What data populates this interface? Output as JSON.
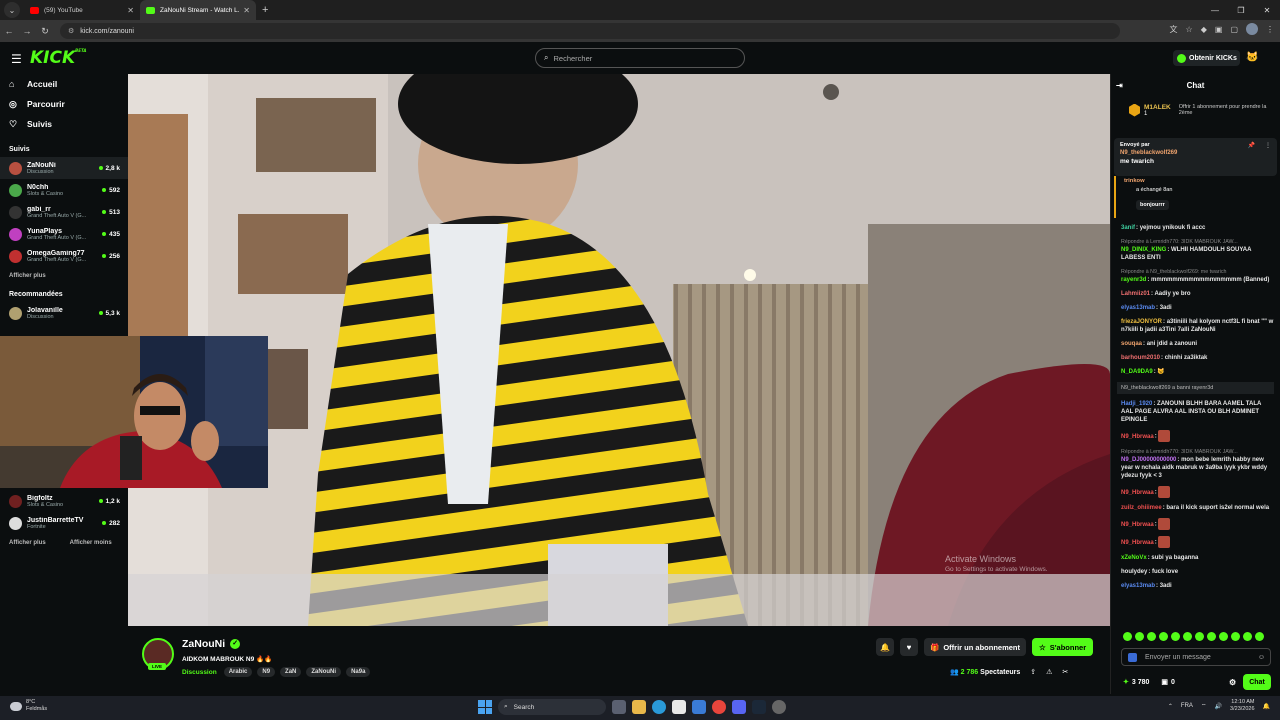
{
  "browser": {
    "tabs": [
      {
        "title": "(59) YouTube",
        "favicon_color": "#ff0000"
      },
      {
        "title": "ZaNouNi Stream - Watch L...",
        "favicon_color": "#53fc18"
      }
    ],
    "address": "kick.com/zanouni"
  },
  "header": {
    "logo": "KICK",
    "logo_sup": "BETA",
    "search_placeholder": "Rechercher",
    "get_kicks": "Obtenir KICKs"
  },
  "sidebar": {
    "nav": [
      {
        "label": "Accueil",
        "icon": "home-icon"
      },
      {
        "label": "Parcourir",
        "icon": "compass-icon"
      },
      {
        "label": "Suivis",
        "icon": "heart-icon"
      }
    ],
    "followed_title": "Suivis",
    "followed": [
      {
        "name": "ZaNouNi",
        "category": "Discussion",
        "viewers": "2,8 k",
        "color": "#b85040"
      },
      {
        "name": "N0chh",
        "category": "Slots & Casino",
        "viewers": "592",
        "color": "#4aa84a"
      },
      {
        "name": "gabi_rr",
        "category": "Grand Theft Auto V (G...",
        "viewers": "513",
        "color": "#333333"
      },
      {
        "name": "YunaPlays",
        "category": "Grand Theft Auto V (G...",
        "viewers": "435",
        "color": "#c040c0"
      },
      {
        "name": "OmegaGaming77",
        "category": "Grand Theft Auto V (G...",
        "viewers": "256",
        "color": "#c03030"
      }
    ],
    "show_more_1": "Afficher plus",
    "recommended_title": "Recommandées",
    "recommended": [
      {
        "name": "Jolavanille",
        "category": "Discussion",
        "viewers": "5,3 k",
        "color": "#b0a070"
      }
    ],
    "recommended_bottom": [
      {
        "name": "Bigfoltz",
        "category": "Slots & Casino",
        "viewers": "1,2 k",
        "color": "#702020"
      },
      {
        "name": "JustinBarretteTV",
        "category": "Fortnite",
        "viewers": "282",
        "color": "#dddddd"
      }
    ],
    "show_more_2": "Afficher plus",
    "show_less": "Afficher moins"
  },
  "video": {
    "watermark_title": "Activate Windows",
    "watermark_sub": "Go to Settings to activate Windows."
  },
  "stream": {
    "streamer": "ZaNouNi",
    "title": "AIDKOM MABROUK N9 🔥🔥",
    "live": "LIVE",
    "category": "Discussion",
    "tags": [
      "Arabic",
      "N9",
      "ZaN",
      "ZaNouNi",
      "Na9a"
    ],
    "gift_sub": "Offrir un abonnement",
    "subscribe": "S'abonner",
    "viewers": "2 786",
    "viewers_label": "Spectateurs"
  },
  "chat": {
    "title": "Chat",
    "top_gifter": {
      "name": "M1ALEK",
      "count": "1",
      "desc": "Offrir 1 abonnement pour prendre la 2ème"
    },
    "pinned": {
      "label": "Envoyé par",
      "user": "N9_theblackwolf269",
      "text": "me twarich"
    },
    "reply": {
      "user": "trinkow",
      "line": "a échangé 8an",
      "quote": "bonjourrr"
    },
    "messages": [
      {
        "user": "3anif",
        "color": "#3fd0a0",
        "text": "yejmou ynikouk fi accc"
      },
      {
        "reply": "Répondre à Lemridh770: 3IDK MABROUK JAW..."
      },
      {
        "user": "N9_DINIX_KING",
        "color": "#53fc18",
        "text": "WLHII HAMDOULH SOUYAA LABESS ENTI"
      },
      {
        "reply": "Répondre à N9_theblackwolf269: me twarich"
      },
      {
        "user": "rayenr3d",
        "color": "#53fc18",
        "text": "mmmmmmmmmmmmmmmmm (Banned)"
      },
      {
        "user": "Lahmiiz01",
        "color": "#f07070",
        "text": "Aadiy ye bro"
      },
      {
        "user": "elyas13mab",
        "color": "#5a8af0",
        "text": "3adi"
      },
      {
        "user": "friezaJONYOR",
        "color": "#f0c040",
        "text": "a3tiniili hal kolyom nctf3L fi bnat \"\" w n7kiili b jadii a3Tini 7alli ZaNouNi"
      },
      {
        "user": "souqaa",
        "color": "#f0a46e",
        "text": "ani jdid a zanouni"
      },
      {
        "user": "barhoum2010",
        "color": "#f07070",
        "text": "chinhi za3iktak"
      },
      {
        "user": "N_DA9DA9",
        "color": "#53fc18",
        "text": "😼"
      },
      {
        "sys": "N9_theblackwolf269 a banni rayenr3d"
      },
      {
        "user": "Hadji_1920",
        "color": "#5a8af0",
        "text": "ZANOUNI BLHH BARA AAMEL TALA AAL PAGE ALVRA AAL INSTA OU BLH ADMINET EPINGLE"
      },
      {
        "user": "N9_Hbrwaa",
        "color": "#f05050",
        "emote": true
      },
      {
        "reply": "Répondre à Lemridh770: 3IDK MABROUK JAW..."
      },
      {
        "user": "N9_DJ00000000000",
        "color": "#c070f0",
        "text": "mon bebe lemrith habby new year w nchala aidk mabruk w 3a9ba lyyk ykbr wddy ydezu fyyk < 3"
      },
      {
        "user": "N9_Hbrwaa",
        "color": "#f05050",
        "emote": true
      },
      {
        "user": "zuilz_ohiiimee",
        "color": "#f05050",
        "text": "bara il kick suport is2el normal wela"
      },
      {
        "user": "N9_Hbrwaa",
        "color": "#f05050",
        "emote": true
      },
      {
        "user": "N9_Hbrwaa",
        "color": "#f05050",
        "emote": true
      },
      {
        "user": "xZeNoVx",
        "color": "#53fc18",
        "text": "subi ya baganna"
      },
      {
        "user": "houlydey",
        "color": "#e8e8e8",
        "text": "fuck love"
      },
      {
        "user": "elyas13mab",
        "color": "#5a8af0",
        "text": "3adi"
      }
    ],
    "send_placeholder": "Envoyer un message",
    "points": "3 780",
    "count": "0",
    "chat_button": "Chat"
  },
  "taskbar": {
    "weather_temp": "8°C",
    "weather_desc": "Feldmås",
    "search": "Search",
    "lang": "FRA",
    "time": "12:10 AM",
    "date": "3/23/2026"
  }
}
